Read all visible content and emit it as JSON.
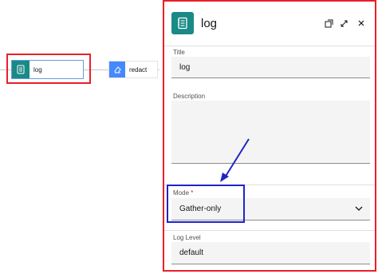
{
  "canvas": {
    "nodes": [
      {
        "label": "log",
        "icon": "notebook-icon",
        "color": "#198a85"
      },
      {
        "label": "redact",
        "icon": "eraser-icon",
        "color": "#4589ff"
      }
    ]
  },
  "panel": {
    "title": "log",
    "icon": "notebook-icon",
    "header_buttons": [
      "external-link-icon",
      "maximize-icon",
      "close-icon"
    ],
    "fields": {
      "title": {
        "label": "Title",
        "value": "log"
      },
      "description": {
        "label": "Description",
        "value": ""
      },
      "mode": {
        "label": "Mode",
        "required_mark": "*",
        "value": "Gather-only"
      },
      "log_level": {
        "label": "Log Level",
        "value": "default"
      }
    }
  },
  "annotations": {
    "highlight_color_red": "#e8202a",
    "highlight_color_blue": "#1f24c7"
  }
}
